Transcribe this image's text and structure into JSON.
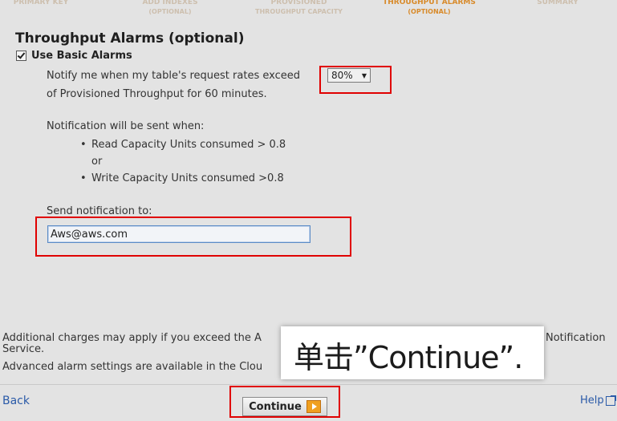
{
  "steps": [
    {
      "label": "PRIMARY KEY",
      "sub": ""
    },
    {
      "label": "ADD INDEXES",
      "sub": "(optional)"
    },
    {
      "label": "PROVISIONED",
      "sub": "THROUGHPUT CAPACITY"
    },
    {
      "label": "THROUGHPUT ALARMS",
      "sub": "(optional)"
    },
    {
      "label": "SUMMARY",
      "sub": ""
    }
  ],
  "section_title": "Throughput Alarms (optional)",
  "basic_alarms": {
    "label": "Use Basic Alarms",
    "checked": true
  },
  "notify": {
    "text_before": "Notify me when my table's request rates exceed",
    "selected_value": "80%",
    "text_after": "of Provisioned Throughput for 60 minutes."
  },
  "notification": {
    "heading": "Notification will be sent when:",
    "read_condition": "Read Capacity Units consumed > 0.8",
    "or": "or",
    "write_condition": "Write Capacity Units consumed >0.8"
  },
  "send_to": {
    "label": "Send notification to:",
    "value": "Aws@aws.com"
  },
  "footer": {
    "charges_line1_start": "Additional charges may apply if you exceed the A",
    "charges_line1_end": "Notification",
    "charges_line2": "Service.",
    "advanced": "Advanced alarm settings are available in the Clou"
  },
  "nav": {
    "back": "Back",
    "continue": "Continue",
    "help": "Help"
  },
  "caption": "单击”Continue”."
}
